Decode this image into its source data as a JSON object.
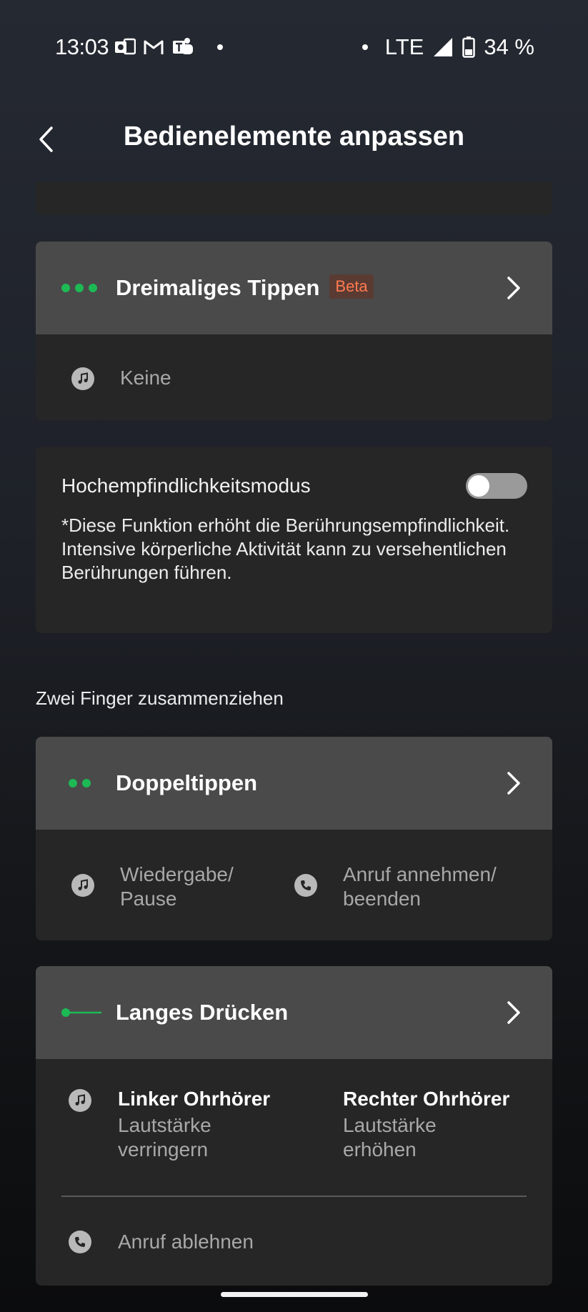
{
  "status_bar": {
    "time": "13:03",
    "network": "LTE",
    "battery": "34 %"
  },
  "header": {
    "title": "Bedienelemente anpassen"
  },
  "triple_tap": {
    "title": "Dreimaliges Tippen",
    "badge": "Beta",
    "action": "Keine"
  },
  "sensitivity": {
    "label": "Hochempfindlichkeitsmodus",
    "description": "*Diese Funktion erhöht die Berührungsempfindlichkeit. Intensive körperliche Aktivität kann zu versehentlichen Berührungen führen.",
    "enabled": false
  },
  "section": {
    "pinch_label": "Zwei Finger zusammenziehen"
  },
  "double_tap": {
    "title": "Doppeltippen",
    "music_action_line1": "Wiedergabe/",
    "music_action_line2": "Pause",
    "call_action_line1": "Anruf annehmen/",
    "call_action_line2": "beenden"
  },
  "long_press": {
    "title": "Langes Drücken",
    "left_title": "Linker Ohrhörer",
    "left_line1": "Lautstärke",
    "left_line2": "verringern",
    "right_title": "Rechter Ohrhörer",
    "right_line1": "Lautstärke",
    "right_line2": "erhöhen",
    "call_action": "Anruf ablehnen"
  },
  "colors": {
    "accent_green": "#1db954",
    "beta_orange": "#ff7b4f",
    "card_header": "#4a4a4a",
    "card_body": "#262626"
  }
}
